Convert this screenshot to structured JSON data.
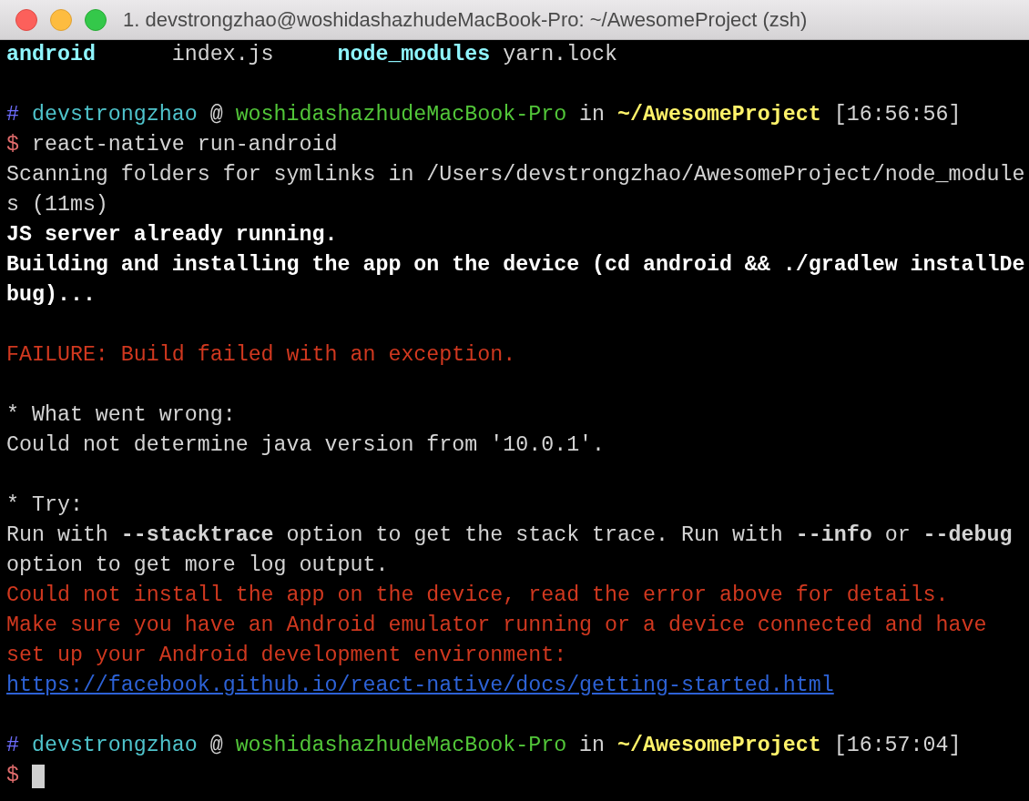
{
  "window": {
    "title": "1. devstrongzhao@woshidashazhudeMacBook-Pro: ~/AwesomeProject (zsh)"
  },
  "lines": [
    {
      "kind": "files",
      "items": [
        {
          "text": "android",
          "kind": "dir"
        },
        {
          "text": "index.js",
          "kind": "file"
        },
        {
          "text": "node_modules",
          "kind": "dir"
        },
        {
          "text": "yarn.lock",
          "kind": "file"
        }
      ]
    },
    {
      "kind": "blank"
    },
    {
      "kind": "prompt",
      "hash": "#",
      "user": "devstrongzhao",
      "at": "@",
      "host": "woshidashazhudeMacBook-Pro",
      "in": "in",
      "path": "~/AwesomeProject",
      "time": "[16:56:56]"
    },
    {
      "kind": "command",
      "sign": "$",
      "text": "react-native run-android"
    },
    {
      "kind": "output",
      "text": "Scanning folders for symlinks in /Users/devstrongzhao/AwesomeProject/node_module"
    },
    {
      "kind": "output",
      "text": "s (11ms)"
    },
    {
      "kind": "notice",
      "text": "JS server already running."
    },
    {
      "kind": "notice",
      "text": "Building and installing the app on the device (cd android && ./gradlew installDe"
    },
    {
      "kind": "notice",
      "text": "bug)..."
    },
    {
      "kind": "blank"
    },
    {
      "kind": "error",
      "text": "FAILURE: Build failed with an exception."
    },
    {
      "kind": "blank"
    },
    {
      "kind": "output",
      "text": "* What went wrong:"
    },
    {
      "kind": "output",
      "text": "Could not determine java version from '10.0.1'."
    },
    {
      "kind": "blank"
    },
    {
      "kind": "output",
      "text": "* Try:"
    },
    {
      "kind": "output",
      "text": "Run with **--stacktrace** option to get the stack trace. Run with **--info** or **--debug**"
    },
    {
      "kind": "output",
      "text": "option to get more log output."
    },
    {
      "kind": "error",
      "text": "Could not install the app on the device, read the error above for details."
    },
    {
      "kind": "error",
      "text": "Make sure you have an Android emulator running or a device connected and have"
    },
    {
      "kind": "error",
      "text": "set up your Android development environment:"
    },
    {
      "kind": "link",
      "text": "https://facebook.github.io/react-native/docs/getting-started.html"
    },
    {
      "kind": "blank"
    },
    {
      "kind": "prompt",
      "hash": "#",
      "user": "devstrongzhao",
      "at": "@",
      "host": "woshidashazhudeMacBook-Pro",
      "in": "in",
      "path": "~/AwesomeProject",
      "time": "[16:57:04]"
    },
    {
      "kind": "input",
      "sign": "$"
    }
  ]
}
